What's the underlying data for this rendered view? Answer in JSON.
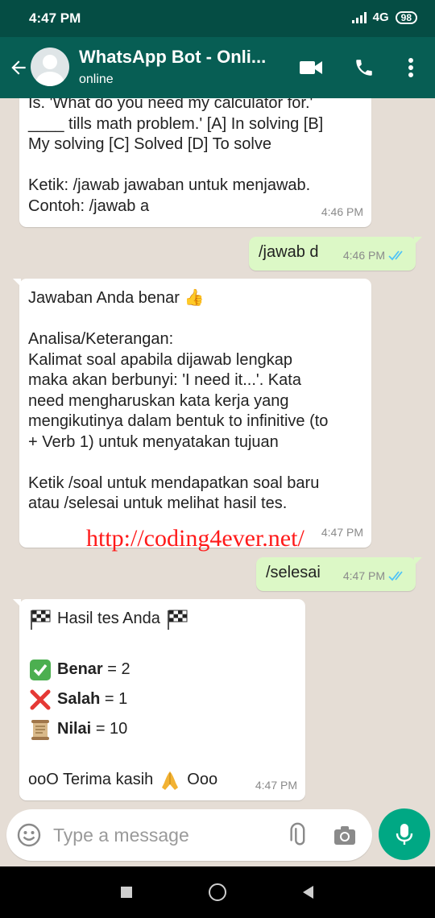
{
  "status_bar": {
    "time": "4:47 PM",
    "network": "4G",
    "battery": "98"
  },
  "header": {
    "title": "WhatsApp Bot - Onli...",
    "status": "online"
  },
  "messages": [
    {
      "direction": "incoming",
      "text": "Is. 'What do you need my calculator for.'\n____ tills math problem.' [A] In solving [B]\nMy solving [C] Solved [D] To solve\n\nKetik: /jawab jawaban untuk menjawab.\nContoh: /jawab a",
      "time": "4:46 PM"
    },
    {
      "direction": "outgoing",
      "text": "/jawab d",
      "time": "4:46 PM",
      "read": true
    },
    {
      "direction": "incoming",
      "text": "Jawaban Anda benar 👍\n\nAnalisa/Keterangan:\nKalimat soal apabila dijawab lengkap\nmaka akan berbunyi: 'I need it...'. Kata\nneed mengharuskan kata kerja yang\nmengikutinya dalam bentuk to infinitive (to\n+ Verb 1) untuk menyatakan tujuan\n\nKetik /soal untuk mendapatkan soal baru\natau /selesai untuk melihat hasil tes.",
      "time": "4:47 PM"
    },
    {
      "direction": "outgoing",
      "text": "/selesai",
      "time": "4:47 PM",
      "read": true
    },
    {
      "direction": "incoming",
      "title": "Hasil tes Anda",
      "results": [
        {
          "icon": "check-mark-icon",
          "label": "Benar",
          "value": "= 2"
        },
        {
          "icon": "cross-mark-icon",
          "label": "Salah",
          "value": "= 1"
        },
        {
          "icon": "scroll-icon",
          "label": "Nilai",
          "value": "= 10"
        }
      ],
      "closing": "ooO Terima kasih",
      "closing_end": "Ooo",
      "time": "4:47 PM"
    }
  ],
  "watermark": "http://coding4ever.net/",
  "input": {
    "placeholder": "Type a message"
  },
  "colors": {
    "header": "#075e54",
    "statusbar": "#054d44",
    "outgoing": "#dcf8c6",
    "incoming": "#ffffff",
    "chat_bg": "#e5ddd5",
    "accent": "#00a884",
    "read_tick": "#4fc3f7"
  }
}
